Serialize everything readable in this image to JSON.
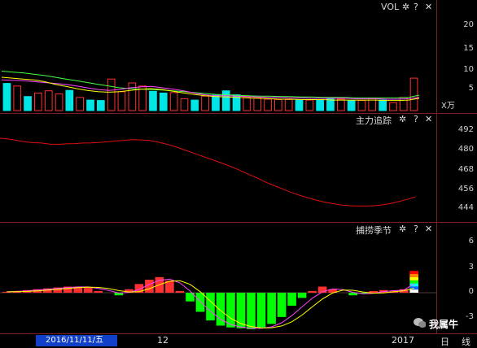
{
  "vol_panel": {
    "title": "VOL",
    "unit": "X万",
    "ticks": [
      "20",
      "15",
      "10",
      "5"
    ]
  },
  "main_force_panel": {
    "title": "主力追踪",
    "ticks": [
      "492",
      "480",
      "468",
      "456",
      "444"
    ]
  },
  "catch_panel": {
    "title": "捕捞季节",
    "ticks": [
      "6",
      "3",
      "0",
      "-3"
    ]
  },
  "controls": {
    "settings": "✲",
    "help": "?",
    "close": "✕"
  },
  "bottom": {
    "date": "2016/11/11/五",
    "month": "12",
    "year": "2017",
    "period": "日",
    "line_label": "线"
  },
  "watermark": {
    "text": "我属牛"
  },
  "colors": {
    "up": "#ff3030",
    "down": "#00e6e6",
    "macd_down": "#00ff00",
    "ma1": "#ffffff",
    "ma2": "#ffff00",
    "ma3": "#ff44ff",
    "ma4": "#44ff44",
    "track": "#e01010"
  },
  "chart_data": [
    {
      "type": "bar",
      "title": "VOL",
      "ylabel": "X万",
      "ylim": [
        0,
        23
      ],
      "series": [
        {
          "values": [
            6.2,
            5.6,
            3.2,
            4.0,
            4.5,
            3.8,
            4.6,
            3.0,
            2.4,
            2.3,
            7.2,
            4.3,
            6.3,
            5.6,
            4.4,
            4.0,
            4.1,
            2.7,
            2.4,
            3.3,
            3.5,
            4.5,
            3.6,
            3.0,
            2.9,
            2.6,
            2.5,
            2.5,
            2.4,
            2.4,
            2.5,
            2.7,
            2.6,
            2.3,
            2.3,
            2.7,
            2.4,
            1.8,
            3.0,
            7.4
          ],
          "up": [
            0,
            1,
            0,
            1,
            1,
            1,
            0,
            1,
            0,
            0,
            1,
            1,
            1,
            1,
            0,
            0,
            1,
            1,
            0,
            1,
            0,
            0,
            0,
            1,
            1,
            1,
            1,
            1,
            0,
            1,
            0,
            0,
            1,
            0,
            1,
            1,
            0,
            1,
            1,
            1
          ]
        },
        {
          "name": "MA5",
          "values": [
            9.0,
            8.8,
            8.6,
            8.3,
            8.0,
            7.6,
            7.2,
            6.8,
            6.4,
            6.0,
            5.6,
            5.2,
            5.0,
            4.9,
            4.8,
            4.7,
            4.5,
            4.3,
            4.1,
            3.9,
            3.7,
            3.6,
            3.5,
            3.4,
            3.3,
            3.3,
            3.2,
            3.2,
            3.1,
            3.1,
            3.0,
            3.0,
            3.0,
            2.9,
            2.9,
            2.9,
            2.9,
            2.9,
            3.0,
            3.5
          ]
        },
        {
          "name": "MA10",
          "values": [
            7.0,
            6.9,
            6.8,
            6.6,
            6.4,
            6.2,
            6.0,
            5.6,
            5.2,
            4.8,
            4.6,
            4.8,
            5.2,
            5.4,
            5.5,
            5.2,
            4.9,
            4.5,
            4.0,
            3.6,
            3.4,
            3.4,
            3.3,
            3.2,
            3.1,
            3.0,
            3.0,
            2.9,
            2.9,
            2.8,
            2.8,
            2.8,
            2.8,
            2.7,
            2.7,
            2.7,
            2.6,
            2.6,
            2.7,
            3.0
          ]
        },
        {
          "name": "MA20",
          "values": [
            7.6,
            7.4,
            7.2,
            7.0,
            6.6,
            6.0,
            5.5,
            5.0,
            4.6,
            4.3,
            4.2,
            4.3,
            4.6,
            4.9,
            5.0,
            4.8,
            4.4,
            4.0,
            3.7,
            3.4,
            3.2,
            3.1,
            3.0,
            2.9,
            2.8,
            2.7,
            2.6,
            2.6,
            2.5,
            2.5,
            2.5,
            2.4,
            2.4,
            2.4,
            2.4,
            2.4,
            2.3,
            2.3,
            2.4,
            2.8
          ]
        }
      ]
    },
    {
      "type": "line",
      "title": "主力追踪",
      "ylim": [
        442,
        498
      ],
      "series": [
        {
          "values": [
            486.5,
            486.0,
            485.3,
            484.5,
            484.0,
            483.8,
            483.2,
            483.1,
            483.4,
            483.5,
            483.8,
            483.9,
            484.2,
            484.5,
            485.0,
            485.3,
            485.7,
            485.5,
            485.2,
            484.4,
            483.3,
            482.0,
            480.4,
            478.8,
            477.2,
            475.6,
            474.0,
            472.4,
            470.6,
            468.6,
            466.6,
            464.6,
            462.4,
            460.6,
            458.8,
            457.0,
            455.4,
            454.0,
            452.7,
            451.6,
            450.8,
            450.0,
            449.6,
            449.4,
            449.4,
            449.5,
            450.0,
            450.7,
            451.8,
            453.0,
            454.3
          ]
        }
      ]
    },
    {
      "type": "bar",
      "title": "捕捞季节",
      "ylim": [
        -4.5,
        7.5
      ],
      "series": [
        {
          "values": [
            0.1,
            0.2,
            0.3,
            0.4,
            0.5,
            0.6,
            0.7,
            0.7,
            0.6,
            0.2,
            0,
            -0.3,
            0.4,
            1.0,
            1.5,
            1.8,
            1.4,
            0.2,
            -1.0,
            -2.2,
            -3.2,
            -3.8,
            -4.0,
            -4.1,
            -4.2,
            -4.0,
            -3.6,
            -2.8,
            -1.5,
            -0.6,
            0.2,
            0.7,
            0.4,
            0,
            -0.3,
            -0.1,
            0.2,
            0.3,
            0.2,
            0.4,
            2.5
          ]
        }
      ]
    }
  ]
}
